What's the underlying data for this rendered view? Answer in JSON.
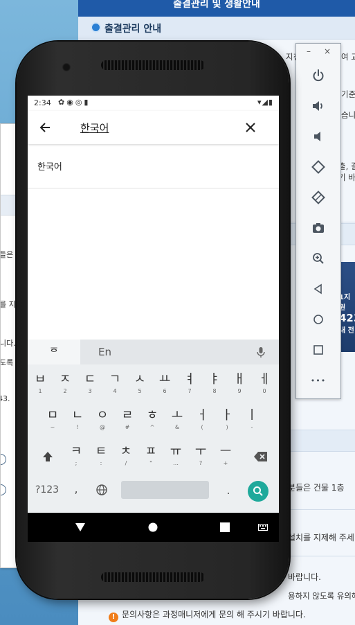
{
  "background_page": {
    "top_title": "출결관리 및 생활안내",
    "section_header": "출결관리 안내",
    "fragments": [
      "지침",
      "여 교",
      "기준",
      "습니",
      "출, 결",
      "기 바",
      "분들은 건물 1층",
      "설치를 지제해 주세",
      "바랍니다.",
      "용하지 않도록 유의해 주",
      "1지원"
    ],
    "banner_number": "423",
    "banner_sub": "내 전",
    "notice_text": "문의사항은 과정매니저에게 문의 해 주시기 바랍니다."
  },
  "left_window": {
    "fragments": [
      "들은",
      "를 지",
      "니다.",
      "도록",
      "43."
    ]
  },
  "emulator_toolbar": {
    "minimize": "–",
    "close": "×",
    "buttons": [
      "power-icon",
      "volume-up-icon",
      "volume-down-icon",
      "rotate-left-icon",
      "rotate-right-icon",
      "camera-icon",
      "zoom-icon",
      "back-icon",
      "home-icon",
      "overview-icon",
      "more-icon"
    ],
    "more_label": "•••"
  },
  "phone": {
    "status": {
      "time": "2:34"
    },
    "search": {
      "query": "한국어"
    },
    "results": [
      "한국어"
    ],
    "keyboard": {
      "suggest_hangul": "ᅙ",
      "suggest_en": "En",
      "row1": [
        [
          "ㅂ",
          "1"
        ],
        [
          "ㅈ",
          "2"
        ],
        [
          "ㄷ",
          "3"
        ],
        [
          "ㄱ",
          "4"
        ],
        [
          "ㅅ",
          "5"
        ],
        [
          "ㅛ",
          "6"
        ],
        [
          "ㅕ",
          "7"
        ],
        [
          "ㅑ",
          "8"
        ],
        [
          "ㅐ",
          "9"
        ],
        [
          "ㅔ",
          "0"
        ]
      ],
      "row2": [
        [
          "ㅁ",
          "~"
        ],
        [
          "ㄴ",
          "!"
        ],
        [
          "ㅇ",
          "@"
        ],
        [
          "ㄹ",
          "#"
        ],
        [
          "ㅎ",
          "^"
        ],
        [
          "ㅗ",
          "&"
        ],
        [
          "ㅓ",
          "("
        ],
        [
          "ㅏ",
          ")"
        ],
        [
          "ㅣ",
          "-"
        ]
      ],
      "row3": [
        [
          "ㅋ",
          ";"
        ],
        [
          "ㅌ",
          ":"
        ],
        [
          "ㅊ",
          "/"
        ],
        [
          "ㅍ",
          "\""
        ],
        [
          "ㅠ",
          "…"
        ],
        [
          "ㅜ",
          "?"
        ],
        [
          "ㅡ",
          "+"
        ]
      ],
      "symbols_key": "?123",
      "comma_key": ",",
      "period_key": "."
    },
    "colors": {
      "enter": "#1fa99b",
      "nav_bg": "#000000"
    }
  }
}
